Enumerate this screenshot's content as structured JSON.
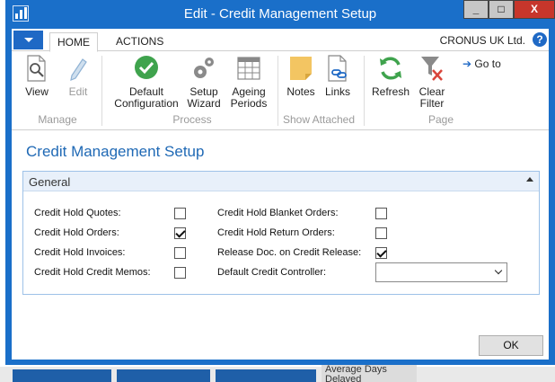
{
  "window": {
    "title": "Edit - Credit Management Setup",
    "minimize": "_",
    "maximize": "□",
    "close": "X"
  },
  "ribbon_tabs": {
    "home": "HOME",
    "actions": "ACTIONS"
  },
  "company": "CRONUS UK Ltd.",
  "help": "?",
  "ribbon": {
    "manage": {
      "label": "Manage",
      "view": "View",
      "edit": "Edit"
    },
    "process": {
      "label": "Process",
      "default_configuration": [
        "Default",
        "Configuration"
      ],
      "setup_wizard": [
        "Setup",
        "Wizard"
      ],
      "ageing_periods": [
        "Ageing",
        "Periods"
      ]
    },
    "show_attached": {
      "label": "Show Attached",
      "notes": "Notes",
      "links": "Links"
    },
    "page": {
      "label": "Page",
      "refresh": "Refresh",
      "clear_filter": [
        "Clear",
        "Filter"
      ],
      "goto": "Go to"
    }
  },
  "page_title": "Credit Management Setup",
  "general": {
    "title": "General",
    "fields_left": [
      {
        "label": "Credit Hold Quotes:",
        "checked": false
      },
      {
        "label": "Credit Hold Orders:",
        "checked": true
      },
      {
        "label": "Credit Hold Invoices:",
        "checked": false
      },
      {
        "label": "Credit Hold Credit Memos:",
        "checked": false
      }
    ],
    "fields_right": [
      {
        "label": "Credit Hold Blanket Orders:",
        "checked": false
      },
      {
        "label": "Credit Hold Return Orders:",
        "checked": false
      },
      {
        "label": "Release Doc. on Credit Release:",
        "checked": true
      }
    ],
    "default_credit_controller": {
      "label": "Default Credit Controller:",
      "value": ""
    }
  },
  "ok_button": "OK",
  "background": {
    "label": "Average Days Delayed"
  },
  "colors": {
    "title_bar": "#1a6fc9",
    "accent": "#1f69b5",
    "close_button": "#c7362b"
  }
}
